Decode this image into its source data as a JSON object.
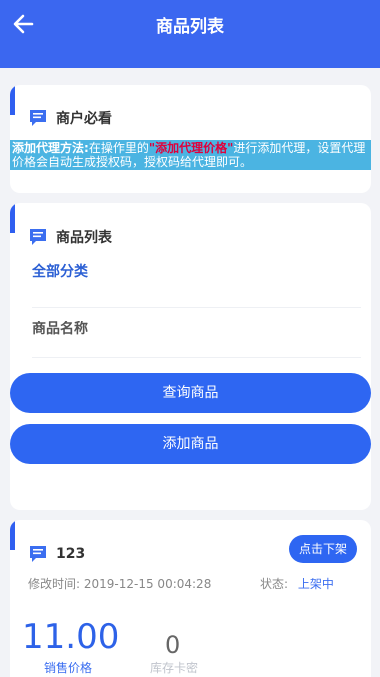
{
  "header": {
    "title": "商品列表",
    "back_icon": "arrow-left-icon"
  },
  "notice_card": {
    "title": "商户必看",
    "prefix": "添加代理方法:",
    "text1": "在操作里的",
    "highlight": "\"添加代理价格\"",
    "text2": "进行添加代理，设置代理价格会自动生成授权码，授权码给代理即可。"
  },
  "list_card": {
    "title": "商品列表",
    "category": "全部分类",
    "search_placeholder": "商品名称",
    "query_button": "查询商品",
    "add_button": "添加商品"
  },
  "product": {
    "name": "123",
    "off_button": "点击下架",
    "modified_label": "修改时间:",
    "modified_value": "2019-12-15 00:04:28",
    "status_label": "状态:",
    "status_value": "上架中",
    "price": "11.00",
    "price_label": "销售价格",
    "stock": "0",
    "stock_label": "库存卡密"
  },
  "colors": {
    "primary": "#2e66f2",
    "header": "#3b67f0",
    "notice_bg": "#4bb4e2",
    "highlight": "#e0003c"
  }
}
